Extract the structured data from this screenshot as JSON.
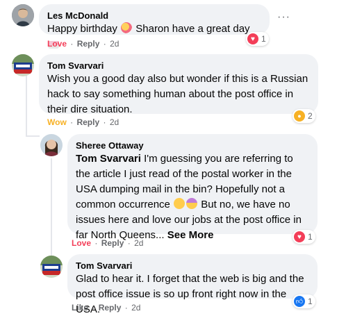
{
  "comments": [
    {
      "author": "Les McDonald",
      "text_before": "Happy birthday",
      "text_after": "Sharon have a great day",
      "actions": {
        "reaction": "Love",
        "reply": "Reply",
        "time": "2d"
      },
      "reaction_count": "1",
      "reaction_type": "love"
    },
    {
      "author": "Tom Svarvari",
      "text": "Wish you a good day also but wonder if this is a Russian hack to say something human about the post office in their dire situation.",
      "actions": {
        "reaction": "Wow",
        "reply": "Reply",
        "time": "2d"
      },
      "reaction_count": "2",
      "reaction_type": "wow"
    },
    {
      "author": "Sheree Ottaway",
      "mention": "Tom Svarvari",
      "text_before": "I'm guessing you are referring to the article I just read of the postal worker in the USA dumping mail in the bin? Hopefully not a common occurrence",
      "text_after": "But no, we have no issues here and love our jobs at the post office in far North Queens...",
      "see_more": "See More",
      "actions": {
        "reaction": "Love",
        "reply": "Reply",
        "time": "2d"
      },
      "reaction_count": "1",
      "reaction_type": "love"
    },
    {
      "author": "Tom Svarvari",
      "text": "Glad to hear it. I forget that the web is big and the post office issue is so up front right now in the USA.",
      "actions": {
        "reaction": "Like",
        "reply": "Reply",
        "time": "2d"
      },
      "reaction_count": "1",
      "reaction_type": "like"
    }
  ],
  "separator": "·",
  "colors": {
    "bubble": "#f0f2f5",
    "love": "#f33e58",
    "wow": "#f7b125",
    "like": "#1877f2",
    "meta": "#65676b"
  }
}
